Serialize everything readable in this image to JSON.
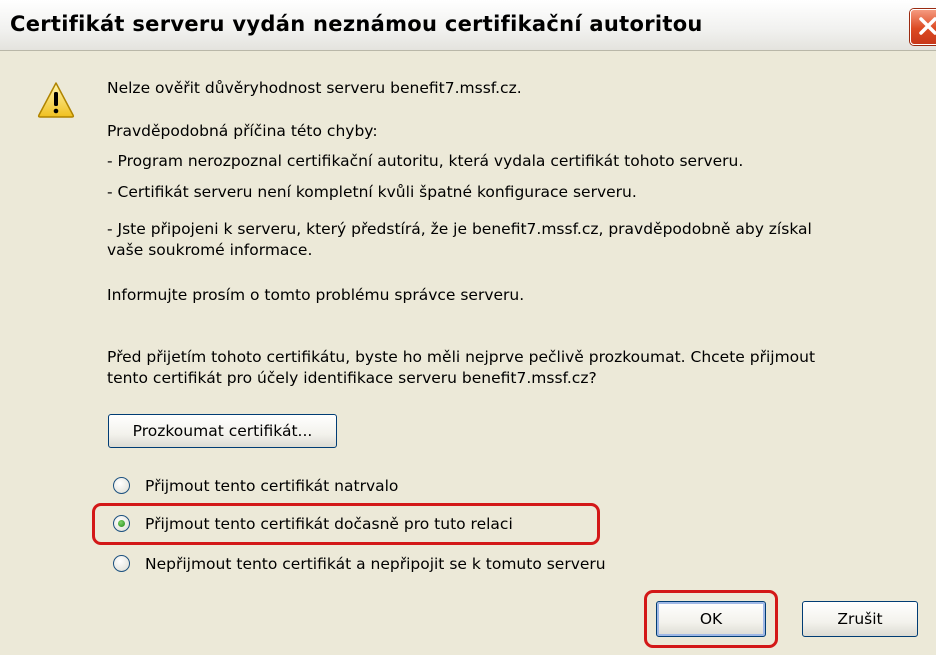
{
  "window": {
    "title": "Certifikát serveru vydán neznámou certifikační autoritou",
    "close_icon": "close-icon",
    "warning_icon": "warning-icon"
  },
  "message": {
    "line1": "Nelze ověřit důvěryhodnost serveru benefit7.mssf.cz.",
    "cause_heading": "Pravděpodobná příčina této chyby:",
    "cause1": "- Program nerozpoznal certifikační autoritu, která vydala certifikát tohoto serveru.",
    "cause2": "- Certifikát serveru není kompletní kvůli špatné konfigurace serveru.",
    "cause3_line1": "- Jste připojeni k serveru, který předstírá, že je benefit7.mssf.cz, pravděpodobně aby získal",
    "cause3_line2": "vaše soukromé informace.",
    "inform": "Informujte prosím o tomto problému správce serveru.",
    "question_line1": "Před přijetím tohoto certifikátu, byste ho měli nejprve pečlivě prozkoumat. Chcete přijmout",
    "question_line2": "tento certifikát pro účely identifikace serveru benefit7.mssf.cz?"
  },
  "buttons": {
    "examine": "Prozkoumat certifikát...",
    "ok": "OK",
    "cancel": "Zrušit"
  },
  "options": [
    {
      "label": "Přijmout tento certifikát natrvalo",
      "selected": false
    },
    {
      "label": "Přijmout tento certifikát dočasně pro tuto relaci",
      "selected": true
    },
    {
      "label": "Nepřijmout tento certifikát a nepřipojit se k tomuto serveru",
      "selected": false
    }
  ],
  "colors": {
    "highlight": "#d31818",
    "dialog_bg": "#ece9d8",
    "close_button": "#dc4a22"
  }
}
